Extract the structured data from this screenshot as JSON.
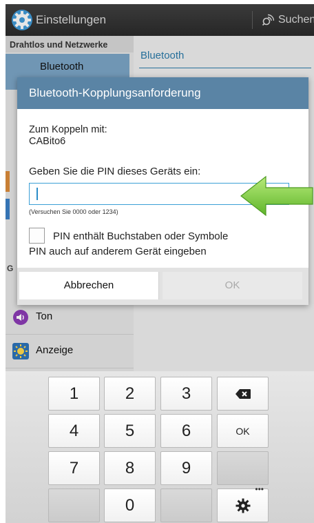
{
  "app": {
    "title": "Einstellungen",
    "search_label": "Suchen"
  },
  "left_pane": {
    "section_header": "Drahtlos und Netzwerke",
    "selected_item": "Bluetooth",
    "group_letter": "G",
    "items": [
      {
        "label": "Ton",
        "icon": "sound-icon"
      },
      {
        "label": "Anzeige",
        "icon": "display-icon"
      }
    ]
  },
  "right_pane": {
    "title": "Bluetooth"
  },
  "dialog": {
    "title": "Bluetooth-Kopplungsanforderung",
    "pair_with_label": "Zum Koppeln mit:",
    "device_name": "CABito6",
    "prompt": "Geben Sie die PIN dieses Geräts ein:",
    "pin_value": "",
    "hint": "(Versuchen Sie 0000 oder 1234)",
    "checkbox_label": "PIN enthält Buchstaben oder Symbole",
    "checkbox_checked": false,
    "other_device_note": "PIN auch auf anderem Gerät eingeben",
    "cancel_label": "Abbrechen",
    "ok_label": "OK",
    "ok_enabled": false
  },
  "keypad": {
    "keys": [
      "1",
      "2",
      "3",
      "4",
      "5",
      "6",
      "7",
      "8",
      "9",
      "0"
    ],
    "ok_label": "OK",
    "backspace_icon": "backspace-icon",
    "settings_icon": "gear-icon"
  },
  "colors": {
    "dialog_title_bg": "#5a84a5",
    "accent": "#2a79a8",
    "input_border": "#3b9fd6",
    "arrow": "#7ccd3c"
  }
}
